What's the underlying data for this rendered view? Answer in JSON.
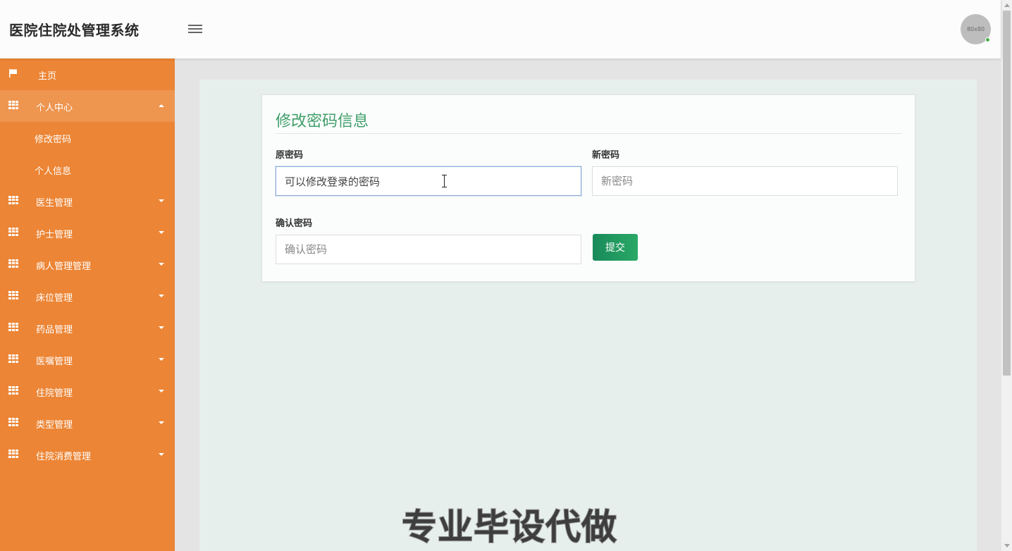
{
  "app": {
    "title": "医院住院处管理系统"
  },
  "header": {
    "avatar_text": "80x80"
  },
  "sidebar": {
    "home": {
      "label": "主页",
      "icon": "flag-icon"
    },
    "personal": {
      "label": "个人中心",
      "expanded": true,
      "children": [
        {
          "label": "修改密码"
        },
        {
          "label": "个人信息"
        }
      ]
    },
    "items": [
      {
        "label": "医生管理"
      },
      {
        "label": "护士管理"
      },
      {
        "label": "病人管理管理"
      },
      {
        "label": "床位管理"
      },
      {
        "label": "药品管理"
      },
      {
        "label": "医嘱管理"
      },
      {
        "label": "住院管理"
      },
      {
        "label": "类型管理"
      },
      {
        "label": "住院消费管理"
      }
    ],
    "color": "#ec8535"
  },
  "form": {
    "title": "修改密码信息",
    "old_password": {
      "label": "原密码",
      "value": "可以修改登录的密码",
      "placeholder": "原密码"
    },
    "new_password": {
      "label": "新密码",
      "value": "",
      "placeholder": "新密码"
    },
    "confirm_password": {
      "label": "确认密码",
      "value": "",
      "placeholder": "确认密码"
    },
    "submit_label": "提交",
    "accent": "#3f9e6a"
  },
  "watermark": "专业毕设代做"
}
